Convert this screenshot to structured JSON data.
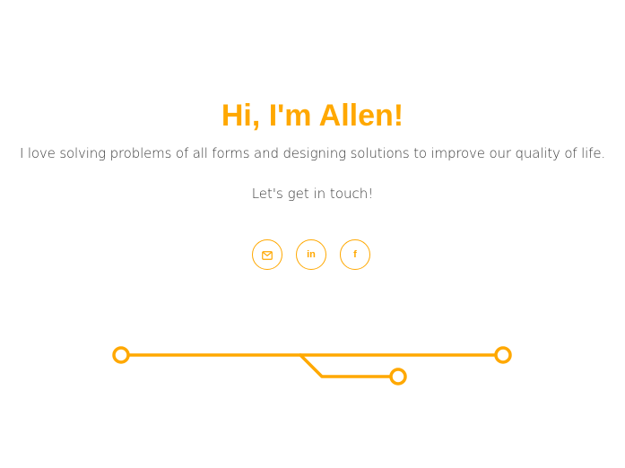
{
  "theme": {
    "accent": "#ffa800",
    "text": "#3a3a3a"
  },
  "hero": {
    "title": "Hi, I'm Allen!",
    "tagline": "I love solving problems of all forms and designing solutions to improve our quality of life.",
    "cta": "Let's get in touch!"
  },
  "social": [
    {
      "icon": "envelope-icon",
      "glyph": ""
    },
    {
      "icon": "linkedin-icon",
      "glyph": "in"
    },
    {
      "icon": "facebook-icon",
      "glyph": "f"
    }
  ]
}
